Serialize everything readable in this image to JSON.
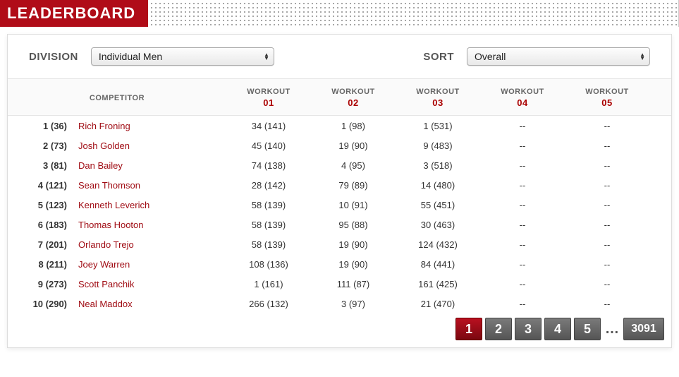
{
  "header": {
    "title": "LEADERBOARD"
  },
  "controls": {
    "division_label": "DIVISION",
    "division_value": "Individual Men",
    "sort_label": "SORT",
    "sort_value": "Overall"
  },
  "columns": {
    "competitor": "COMPETITOR",
    "workout_label": "WORKOUT",
    "workouts": [
      "01",
      "02",
      "03",
      "04",
      "05"
    ]
  },
  "rows": [
    {
      "rank": "1 (36)",
      "name": "Rich Froning",
      "w": [
        "34 (141)",
        "1 (98)",
        "1 (531)",
        "--",
        "--"
      ]
    },
    {
      "rank": "2 (73)",
      "name": "Josh Golden",
      "w": [
        "45 (140)",
        "19 (90)",
        "9 (483)",
        "--",
        "--"
      ]
    },
    {
      "rank": "3 (81)",
      "name": "Dan Bailey",
      "w": [
        "74 (138)",
        "4 (95)",
        "3 (518)",
        "--",
        "--"
      ]
    },
    {
      "rank": "4 (121)",
      "name": "Sean Thomson",
      "w": [
        "28 (142)",
        "79 (89)",
        "14 (480)",
        "--",
        "--"
      ]
    },
    {
      "rank": "5 (123)",
      "name": "Kenneth Leverich",
      "w": [
        "58 (139)",
        "10 (91)",
        "55 (451)",
        "--",
        "--"
      ]
    },
    {
      "rank": "6 (183)",
      "name": "Thomas Hooton",
      "w": [
        "58 (139)",
        "95 (88)",
        "30 (463)",
        "--",
        "--"
      ]
    },
    {
      "rank": "7 (201)",
      "name": "Orlando Trejo",
      "w": [
        "58 (139)",
        "19 (90)",
        "124 (432)",
        "--",
        "--"
      ]
    },
    {
      "rank": "8 (211)",
      "name": "Joey Warren",
      "w": [
        "108 (136)",
        "19 (90)",
        "84 (441)",
        "--",
        "--"
      ]
    },
    {
      "rank": "9 (273)",
      "name": "Scott Panchik",
      "w": [
        "1 (161)",
        "111 (87)",
        "161 (425)",
        "--",
        "--"
      ]
    },
    {
      "rank": "10 (290)",
      "name": "Neal Maddox",
      "w": [
        "266 (132)",
        "3 (97)",
        "21 (470)",
        "--",
        "--"
      ]
    }
  ],
  "pager": {
    "pages": [
      "1",
      "2",
      "3",
      "4",
      "5"
    ],
    "active": "1",
    "ellipsis": "…",
    "last": "3091"
  }
}
